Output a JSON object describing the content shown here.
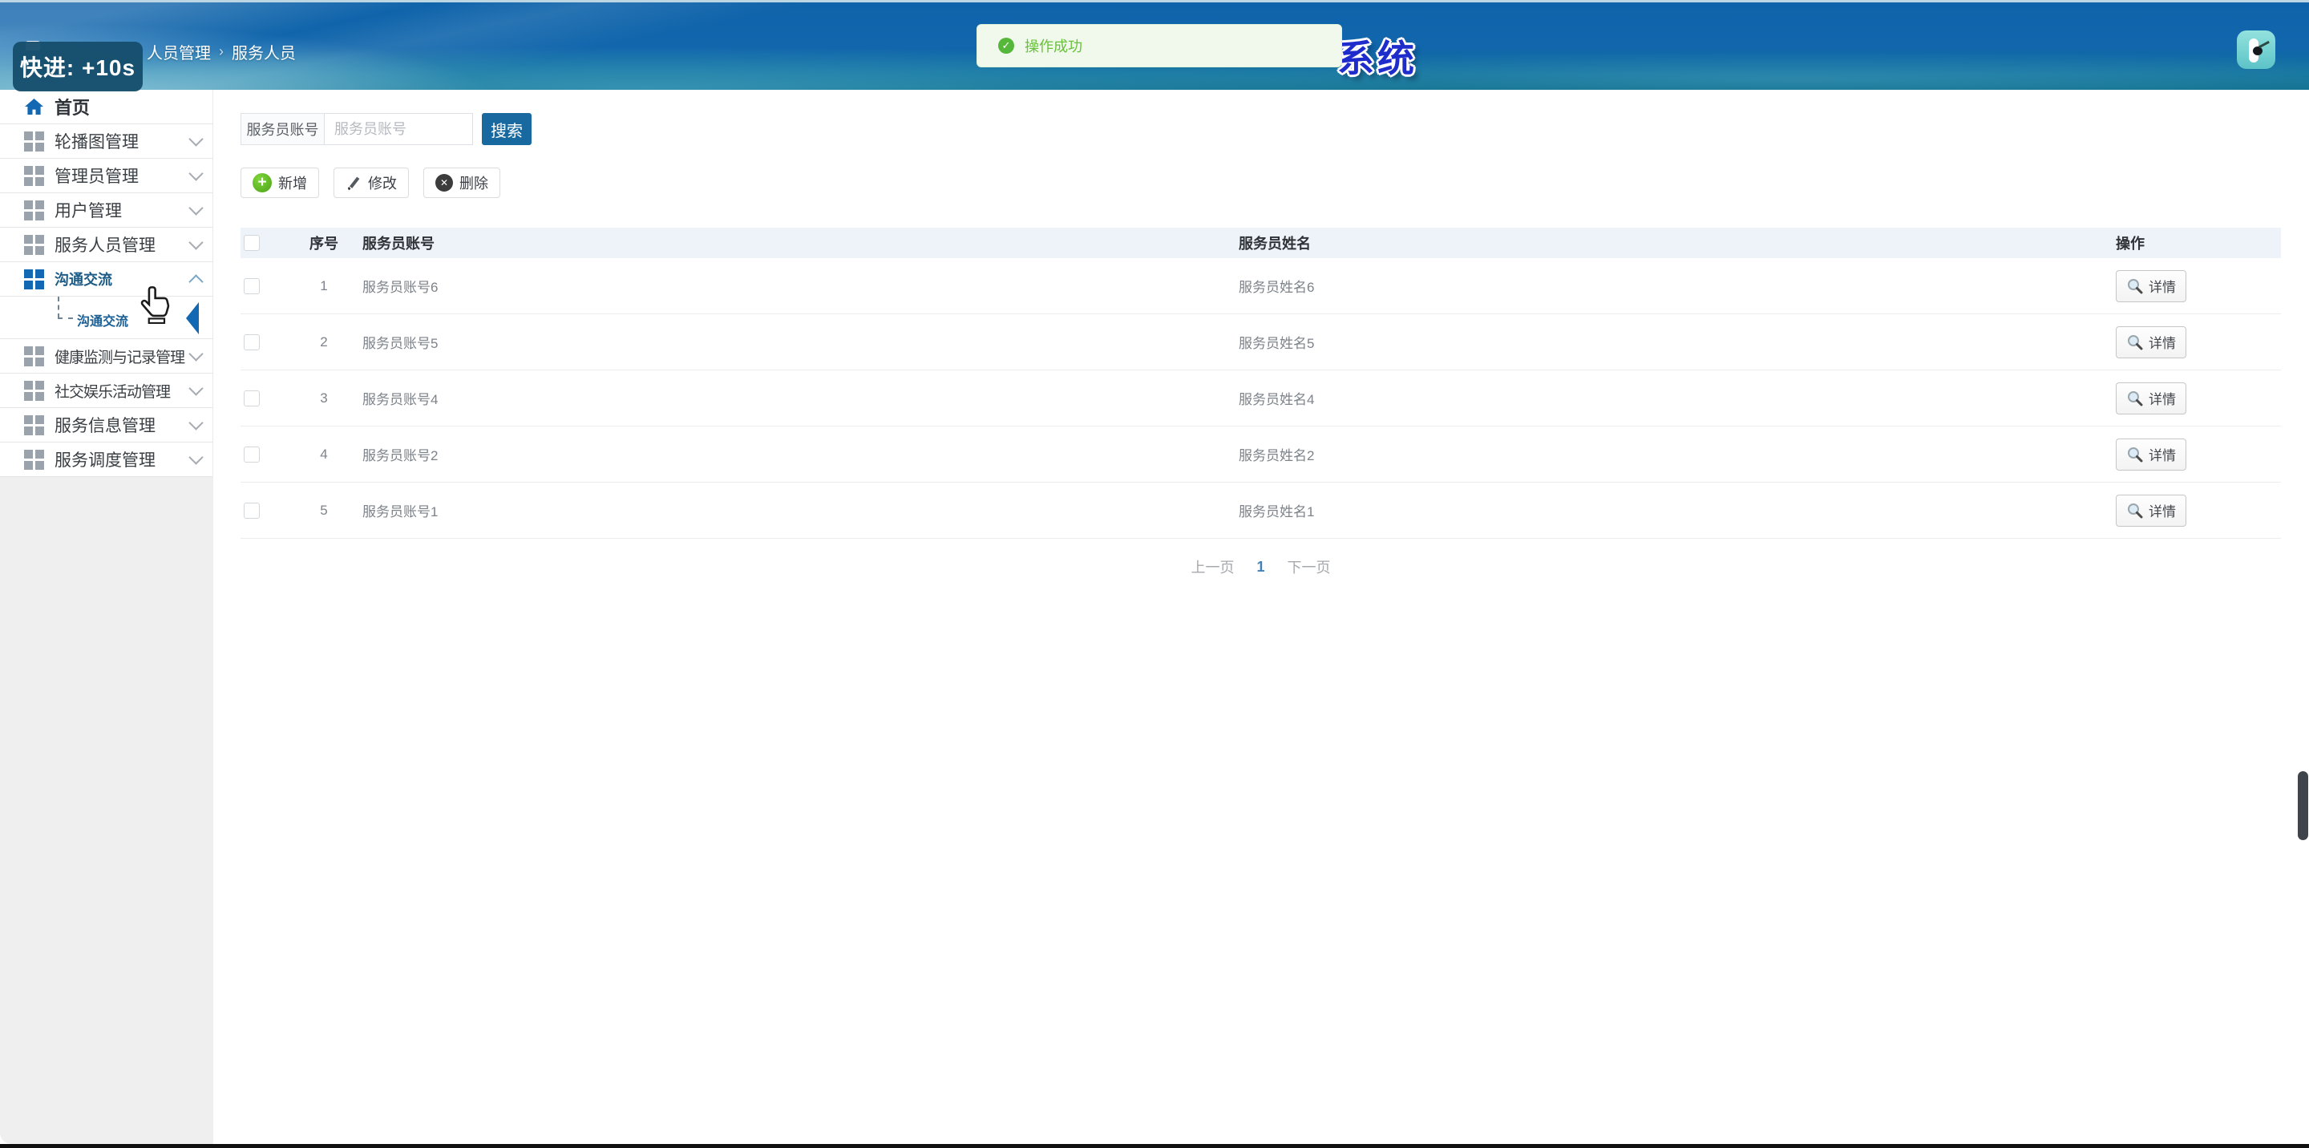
{
  "header": {
    "title_visible": "系统",
    "breadcrumb": {
      "items": [
        "人员管理",
        "服务人员"
      ],
      "separator": "›"
    }
  },
  "video_overlay": {
    "text": "快进: +10s"
  },
  "toast": {
    "text": "操作成功",
    "icon": "success-check-circle"
  },
  "sidebar": {
    "items": [
      {
        "label": "首页",
        "icon": "home-icon"
      },
      {
        "label": "轮播图管理",
        "icon": "grid-icon",
        "chevron": "down"
      },
      {
        "label": "管理员管理",
        "icon": "grid-icon",
        "chevron": "down"
      },
      {
        "label": "用户管理",
        "icon": "grid-icon",
        "chevron": "down"
      },
      {
        "label": "服务人员管理",
        "icon": "grid-icon",
        "chevron": "down"
      },
      {
        "label": "沟通交流",
        "icon": "grid-icon",
        "chevron": "up",
        "active": true
      },
      {
        "label": "健康监测与记录管理",
        "icon": "grid-icon",
        "chevron": "down"
      },
      {
        "label": "社交娱乐活动管理",
        "icon": "grid-icon",
        "chevron": "down"
      },
      {
        "label": "服务信息管理",
        "icon": "grid-icon",
        "chevron": "down"
      },
      {
        "label": "服务调度管理",
        "icon": "grid-icon",
        "chevron": "down"
      }
    ],
    "submenu": {
      "label": "沟通交流",
      "active": true
    }
  },
  "search": {
    "label": "服务员账号",
    "placeholder": "服务员账号",
    "button": "搜索"
  },
  "toolbar": {
    "add": "新增",
    "edit": "修改",
    "delete": "删除"
  },
  "table": {
    "columns": {
      "index": "序号",
      "account": "服务员账号",
      "name": "服务员姓名",
      "action": "操作"
    },
    "rows": [
      {
        "index": "1",
        "account": "服务员账号6",
        "name": "服务员姓名6",
        "action": "详情"
      },
      {
        "index": "2",
        "account": "服务员账号5",
        "name": "服务员姓名5",
        "action": "详情"
      },
      {
        "index": "3",
        "account": "服务员账号4",
        "name": "服务员姓名4",
        "action": "详情"
      },
      {
        "index": "4",
        "account": "服务员账号2",
        "name": "服务员姓名2",
        "action": "详情"
      },
      {
        "index": "5",
        "account": "服务员账号1",
        "name": "服务员姓名1",
        "action": "详情"
      }
    ]
  },
  "pagination": {
    "prev": "上一页",
    "current": "1",
    "next": "下一页"
  },
  "colors": {
    "accent": "#1268b3",
    "success": "#67c23a",
    "title_blue": "#1f2ccc",
    "header_top": "#0f63aa",
    "table_head_bg": "#edf3f8"
  }
}
